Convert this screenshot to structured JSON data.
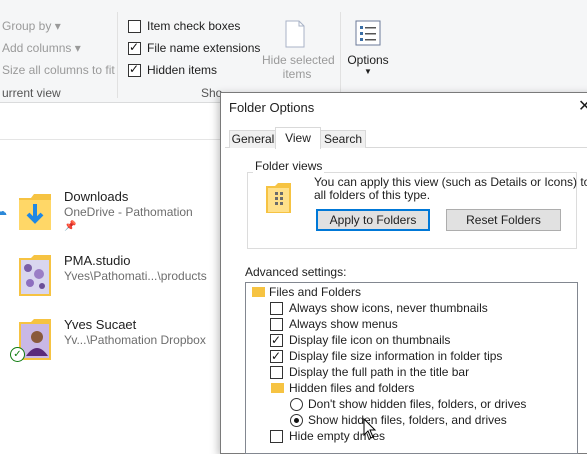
{
  "ribbon": {
    "sort_by": "Group by",
    "add_columns": "Add columns",
    "size_columns": "Size all columns to fit",
    "current_view": "urrent view",
    "item_check_boxes": {
      "label": "Item check boxes",
      "checked": false
    },
    "file_name_extensions": {
      "label": "File name extensions",
      "checked": true
    },
    "hidden_items": {
      "label": "Hidden items",
      "checked": true
    },
    "show_hide_group": "Sho",
    "hide_selected_1": "Hide selected",
    "hide_selected_2": "items",
    "options": "Options"
  },
  "files": [
    {
      "name": "Downloads",
      "sub": "OneDrive - Pathomation"
    },
    {
      "name": "PMA.studio",
      "sub": "Yves\\Pathomati...\\products"
    },
    {
      "name": "Yves Sucaet",
      "sub": "Yv...\\Pathomation Dropbox"
    }
  ],
  "dialog": {
    "title": "Folder Options",
    "close": "✕",
    "tabs": [
      "General",
      "View",
      "Search"
    ],
    "active_tab": "View",
    "folder_views": {
      "legend": "Folder views",
      "text_1": "You can apply this view (such as Details or Icons) to",
      "text_2": "all folders of this type.",
      "apply_button": "Apply to Folders",
      "reset_button": "Reset Folders"
    },
    "advanced_label": "Advanced settings:",
    "tree": [
      {
        "type": "folder",
        "label": "Files and Folders"
      },
      {
        "type": "check",
        "label": "Always show icons, never thumbnails",
        "checked": false
      },
      {
        "type": "check",
        "label": "Always show menus",
        "checked": false
      },
      {
        "type": "check",
        "label": "Display file icon on thumbnails",
        "checked": true
      },
      {
        "type": "check",
        "label": "Display file size information in folder tips",
        "checked": true
      },
      {
        "type": "check",
        "label": "Display the full path in the title bar",
        "checked": false
      },
      {
        "type": "folder",
        "label": "Hidden files and folders"
      },
      {
        "type": "radio",
        "label": "Don't show hidden files, folders, or drives",
        "checked": false
      },
      {
        "type": "radio",
        "label": "Show hidden files, folders, and drives",
        "checked": true
      },
      {
        "type": "check",
        "label": "Hide empty drives",
        "checked": false
      }
    ]
  },
  "colors": {
    "accent": "#0078d7",
    "folder": "#f6c342"
  }
}
